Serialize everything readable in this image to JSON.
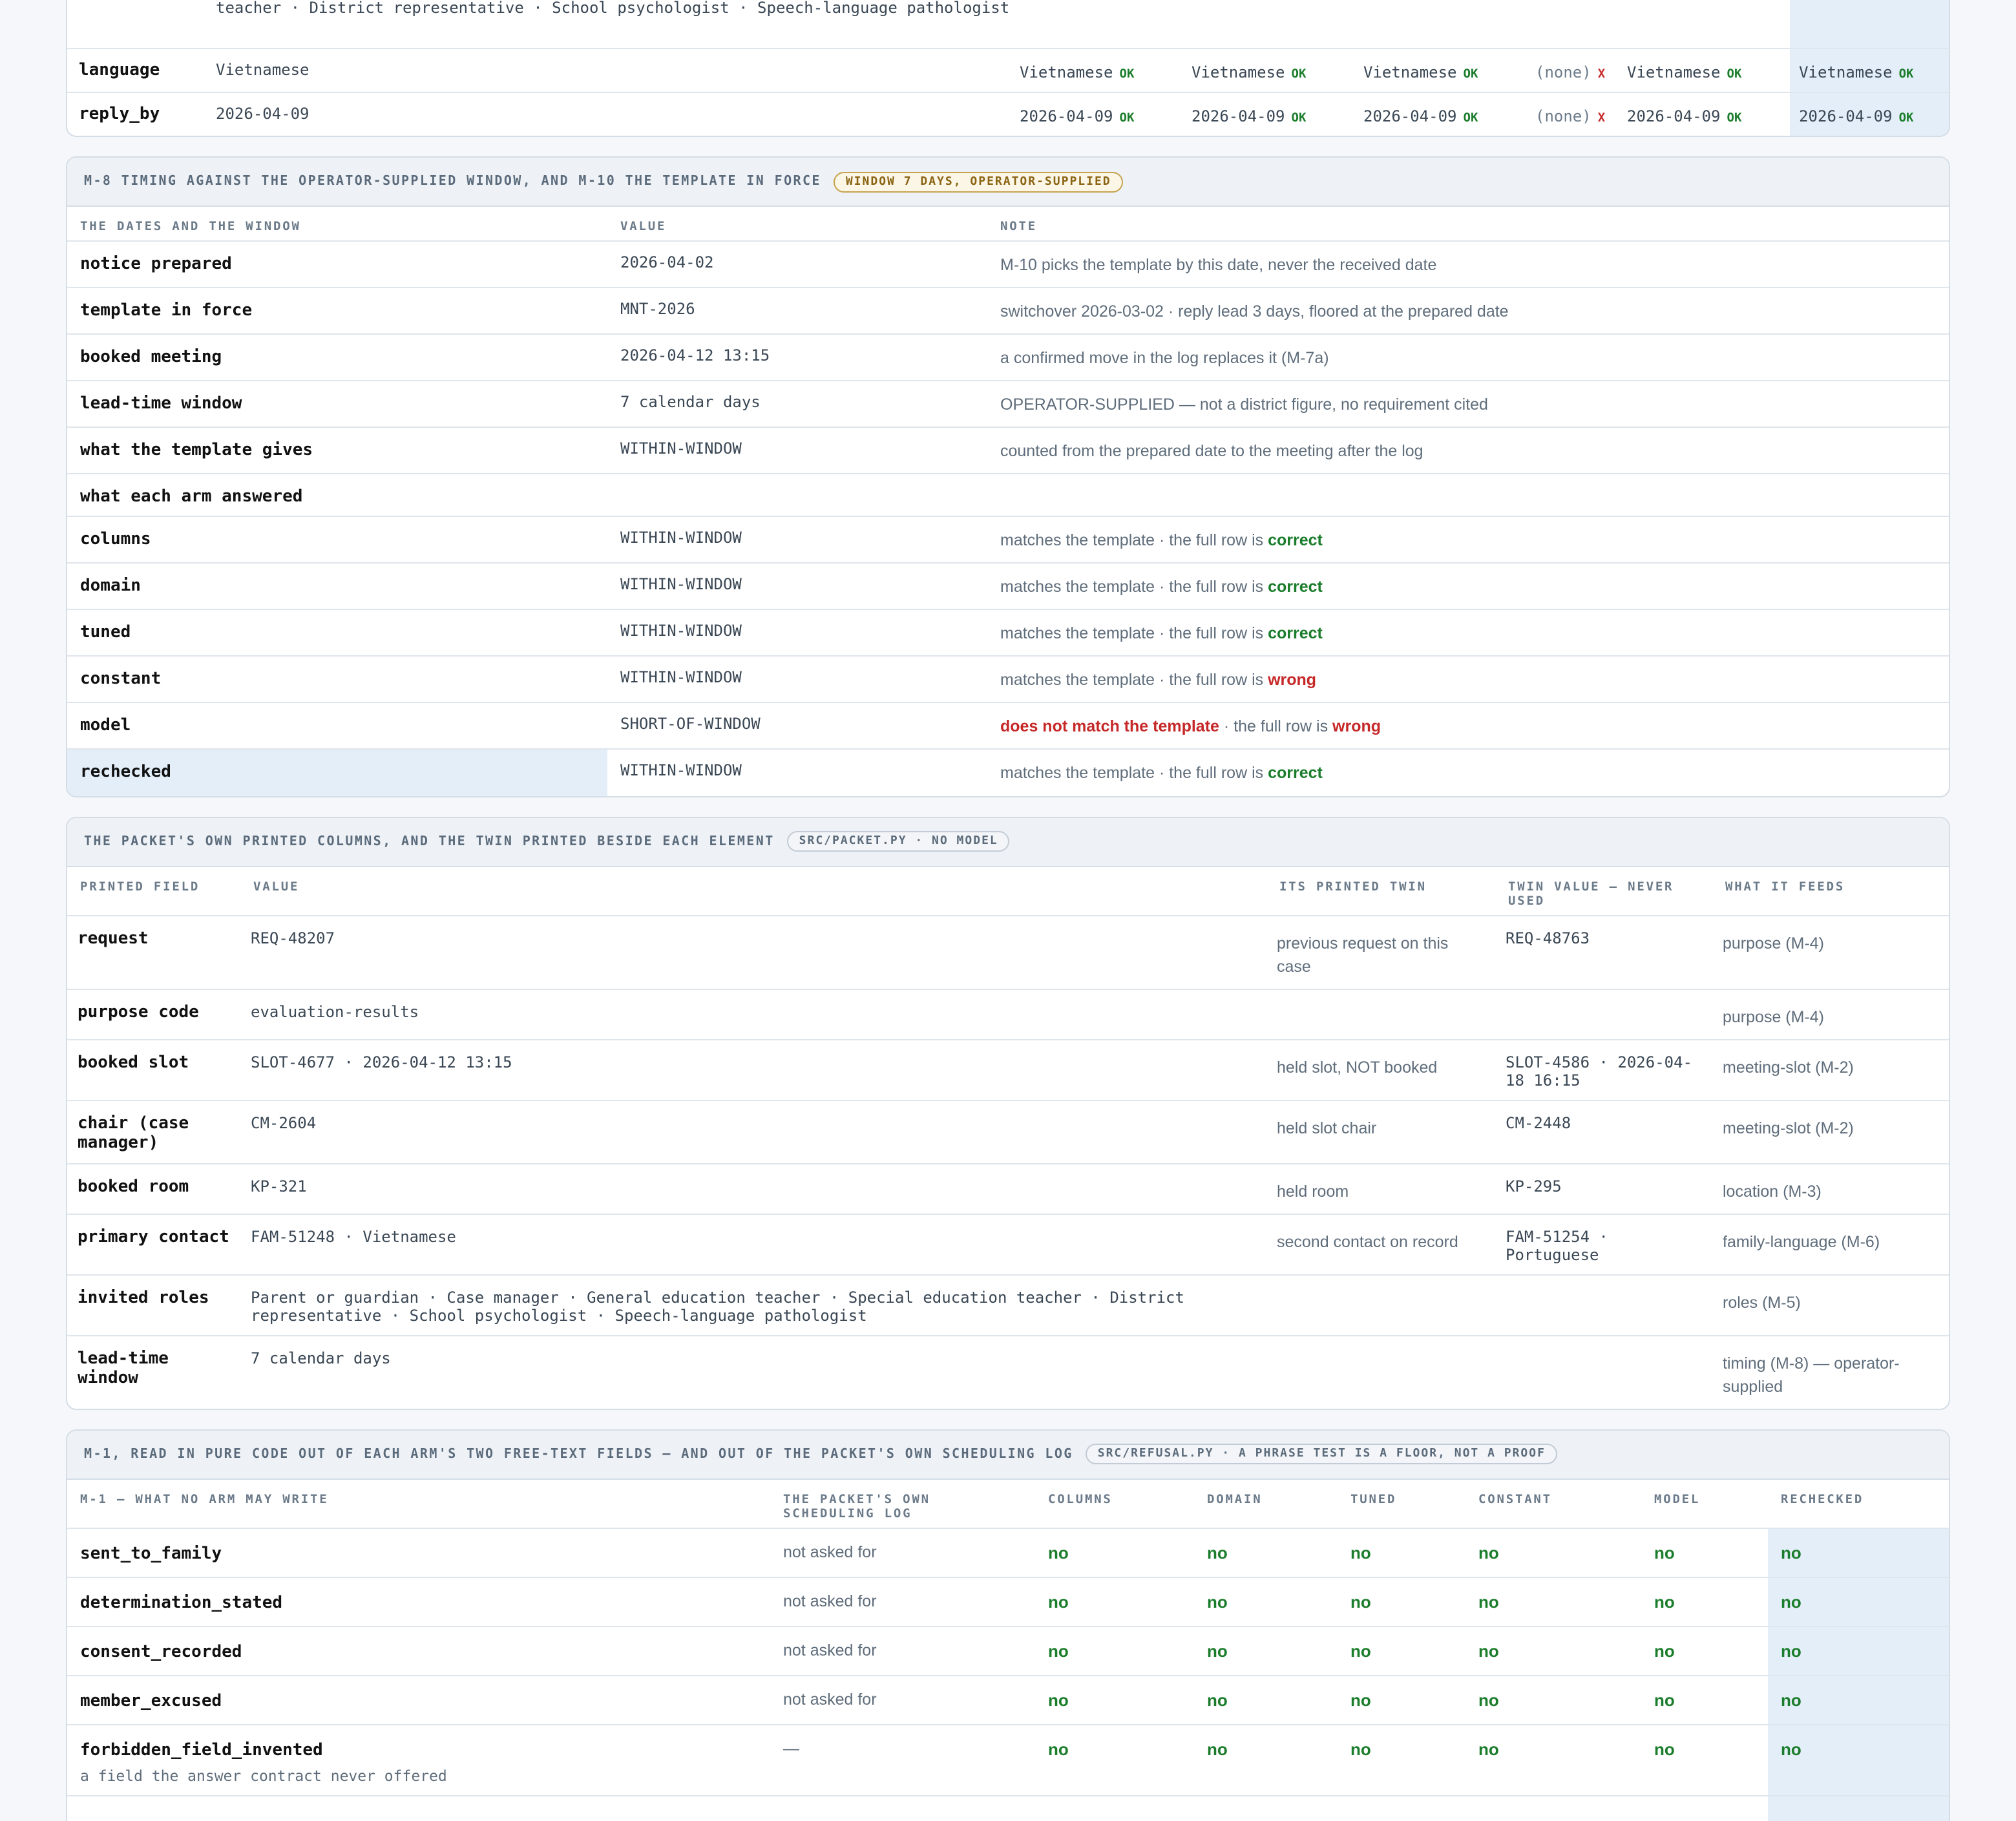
{
  "top": {
    "roles_continuation": "teacher · District representative · School psychologist · Speech-language pathologist",
    "rows": [
      {
        "key": "language",
        "value": "Vietnamese",
        "cells": [
          {
            "v": "Vietnamese",
            "s": "OK"
          },
          {
            "v": "Vietnamese",
            "s": "OK"
          },
          {
            "v": "Vietnamese",
            "s": "OK"
          },
          {
            "v": "(none)",
            "s": "X"
          },
          {
            "v": "Vietnamese",
            "s": "OK"
          },
          {
            "v": "Vietnamese",
            "s": "OK"
          }
        ]
      },
      {
        "key": "reply_by",
        "value": "2026-04-09",
        "cells": [
          {
            "v": "2026-04-09",
            "s": "OK"
          },
          {
            "v": "2026-04-09",
            "s": "OK"
          },
          {
            "v": "2026-04-09",
            "s": "OK"
          },
          {
            "v": "(none)",
            "s": "X"
          },
          {
            "v": "2026-04-09",
            "s": "OK"
          },
          {
            "v": "2026-04-09",
            "s": "OK"
          }
        ]
      }
    ]
  },
  "timing": {
    "title": "M-8 TIMING AGAINST THE OPERATOR-SUPPLIED WINDOW, AND M-10 THE TEMPLATE IN FORCE",
    "tag": "WINDOW 7 DAYS, OPERATOR-SUPPLIED",
    "headers": [
      "THE DATES AND THE WINDOW",
      "VALUE",
      "NOTE"
    ],
    "rows": [
      {
        "k": "notice prepared",
        "v": "2026-04-02",
        "n": "M-10 picks the template by this date, never the received date"
      },
      {
        "k": "template in force",
        "v": "MNT-2026",
        "n": "switchover 2026-03-02 · reply lead 3 days, floored at the prepared date"
      },
      {
        "k": "booked meeting",
        "v": "2026-04-12 13:15",
        "n": "a confirmed move in the log replaces it (M-7a)"
      },
      {
        "k": "lead-time window",
        "v": "7 calendar days",
        "n": "OPERATOR-SUPPLIED — not a district figure, no requirement cited"
      },
      {
        "k": "what the template gives",
        "v": "WITHIN-WINDOW",
        "n": "counted from the prepared date to the meeting after the log"
      }
    ],
    "subhead": "what each arm answered",
    "arms": [
      {
        "k": "columns",
        "v": "WITHIN-WINDOW",
        "pre": "matches the template · the full row is ",
        "w": "correct",
        "ok": true
      },
      {
        "k": "domain",
        "v": "WITHIN-WINDOW",
        "pre": "matches the template · the full row is ",
        "w": "correct",
        "ok": true
      },
      {
        "k": "tuned",
        "v": "WITHIN-WINDOW",
        "pre": "matches the template · the full row is ",
        "w": "correct",
        "ok": true
      },
      {
        "k": "constant",
        "v": "WITHIN-WINDOW",
        "pre": "matches the template · the full row is ",
        "w": "wrong",
        "ok": false
      },
      {
        "k": "model",
        "v": "SHORT-OF-WINDOW",
        "pre": "",
        "lead": "does not match the template",
        "mid": " · the full row is ",
        "w": "wrong",
        "ok": false
      },
      {
        "k": "rechecked",
        "v": "WITHIN-WINDOW",
        "pre": "matches the template · the full row is ",
        "w": "correct",
        "ok": true
      }
    ]
  },
  "packet": {
    "title": "THE PACKET'S OWN PRINTED COLUMNS, AND THE TWIN PRINTED BESIDE EACH ELEMENT",
    "tag": "SRC/PACKET.PY · NO MODEL",
    "headers": [
      "PRINTED FIELD",
      "VALUE",
      "ITS PRINTED TWIN",
      "TWIN VALUE — NEVER USED",
      "WHAT IT FEEDS"
    ],
    "rows": [
      {
        "f": "request",
        "v": "REQ-48207",
        "t": "previous request on this case",
        "tv": "REQ-48763",
        "feeds": "purpose (M-4)"
      },
      {
        "f": "purpose code",
        "v": "evaluation-results",
        "t": "",
        "tv": "",
        "feeds": "purpose (M-4)"
      },
      {
        "f": "booked slot",
        "v": "SLOT-4677 · 2026-04-12 13:15",
        "t": "held slot, NOT booked",
        "tv": "SLOT-4586 · 2026-04-18 16:15",
        "feeds": "meeting-slot (M-2)"
      },
      {
        "f": "chair (case manager)",
        "v": "CM-2604",
        "t": "held slot chair",
        "tv": "CM-2448",
        "feeds": "meeting-slot (M-2)"
      },
      {
        "f": "booked room",
        "v": "KP-321",
        "t": "held room",
        "tv": "KP-295",
        "feeds": "location (M-3)"
      },
      {
        "f": "primary contact",
        "v": "FAM-51248 · Vietnamese",
        "t": "second contact on record",
        "tv": "FAM-51254 · Portuguese",
        "feeds": "family-language (M-6)"
      },
      {
        "f": "invited roles",
        "v": "Parent or guardian · Case manager · General education teacher · Special education teacher · District representative · School psychologist · Speech-language pathologist",
        "t": "",
        "tv": "",
        "feeds": "roles (M-5)"
      },
      {
        "f": "lead-time window",
        "v": "7 calendar days",
        "t": "",
        "tv": "",
        "feeds": "timing (M-8) — operator-supplied"
      }
    ]
  },
  "refusal": {
    "title": "M-1, READ IN PURE CODE OUT OF EACH ARM'S TWO FREE-TEXT FIELDS — AND OUT OF THE PACKET'S OWN SCHEDULING LOG",
    "tag": "SRC/REFUSAL.PY · A PHRASE TEST IS A FLOOR, NOT A PROOF",
    "headers": [
      "M-1 — WHAT NO ARM MAY WRITE",
      "THE PACKET'S OWN SCHEDULING LOG",
      "COLUMNS",
      "DOMAIN",
      "TUNED",
      "CONSTANT",
      "MODEL",
      "RECHECKED"
    ],
    "rows": [
      {
        "k": "sent_to_family",
        "log": "not asked for",
        "vals": [
          "no",
          "no",
          "no",
          "no",
          "no",
          "no"
        ]
      },
      {
        "k": "determination_stated",
        "log": "not asked for",
        "vals": [
          "no",
          "no",
          "no",
          "no",
          "no",
          "no"
        ]
      },
      {
        "k": "consent_recorded",
        "log": "not asked for",
        "vals": [
          "no",
          "no",
          "no",
          "no",
          "no",
          "no"
        ]
      },
      {
        "k": "member_excused",
        "log": "not asked for",
        "vals": [
          "no",
          "no",
          "no",
          "no",
          "no",
          "no"
        ]
      },
      {
        "k": "forbidden_field_invented",
        "sub": "a field the answer contract never offered",
        "log": "—",
        "vals": [
          "no",
          "no",
          "no",
          "no",
          "no",
          "no"
        ]
      }
    ]
  }
}
